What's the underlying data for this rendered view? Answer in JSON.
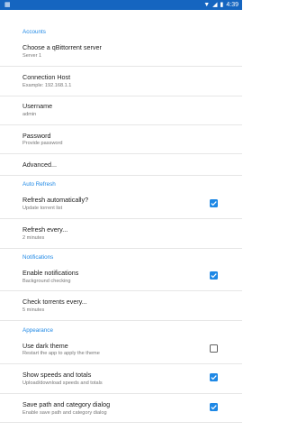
{
  "status_bar": {
    "left_icon": "notification-icon",
    "wifi_icon": "wifi-icon",
    "signal_icon": "signal-icon",
    "battery_icon": "battery-icon",
    "time": "4:39"
  },
  "sections": {
    "accounts": "Accounts",
    "auto_refresh": "Auto Refresh",
    "notifications": "Notifications",
    "appearance": "Appearance"
  },
  "items": {
    "server": {
      "title": "Choose a qBittorrent server",
      "subtitle": "Server 1"
    },
    "host": {
      "title": "Connection Host",
      "subtitle": "Example: 192.168.1.1"
    },
    "username": {
      "title": "Username",
      "subtitle": "admin"
    },
    "password": {
      "title": "Password",
      "subtitle": "Provide password"
    },
    "advanced": {
      "title": "Advanced..."
    },
    "refresh_auto": {
      "title": "Refresh automatically?",
      "subtitle": "Update torrent list",
      "checked": true
    },
    "refresh_every": {
      "title": "Refresh every...",
      "subtitle": "2 minutes"
    },
    "enable_notifications": {
      "title": "Enable notifications",
      "subtitle": "Background checking",
      "checked": true
    },
    "check_every": {
      "title": "Check torrents every...",
      "subtitle": "5 minutes"
    },
    "dark_theme": {
      "title": "Use dark theme",
      "subtitle": "Restart the app to apply the theme",
      "checked": false
    },
    "speeds": {
      "title": "Show speeds and totals",
      "subtitle": "Upload/download speeds and totals",
      "checked": true
    },
    "save_path": {
      "title": "Save path and category dialog",
      "subtitle": "Enable save path and category dialog",
      "checked": true
    }
  },
  "colors": {
    "accent": "#1e88e5",
    "status_bar": "#1565c0"
  }
}
